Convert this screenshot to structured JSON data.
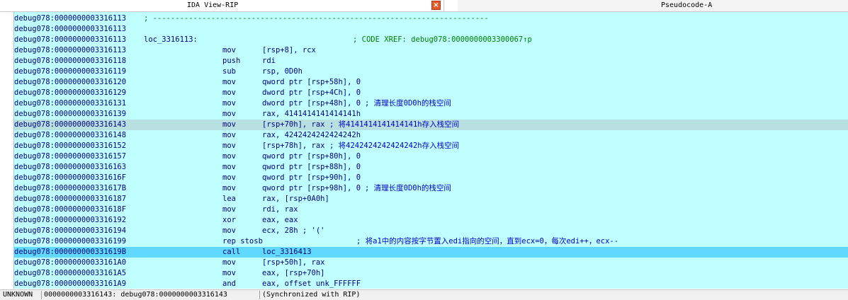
{
  "tabs": {
    "ida_view": "IDA View-RIP",
    "close": "×",
    "pseudocode": "Pseudocode-A"
  },
  "rows": [
    {
      "addr": "debug078:0000000003316113",
      "sep": "; ---------------------------------------------------------------------------"
    },
    {
      "addr": "debug078:0000000003316113"
    },
    {
      "addr": "debug078:0000000003316113",
      "label": "loc_3316113:",
      "comment": "; CODE XREF: debug078:0000000003300067↑p"
    },
    {
      "addr": "debug078:0000000003316113",
      "mn": "mov",
      "op": "[rsp+8], rcx"
    },
    {
      "addr": "debug078:0000000003316118",
      "mn": "push",
      "op": "rdi"
    },
    {
      "addr": "debug078:0000000003316119",
      "mn": "sub",
      "op": "rsp, 0D0h"
    },
    {
      "addr": "debug078:0000000003316120",
      "mn": "mov",
      "op": "qword ptr [rsp+58h], 0"
    },
    {
      "addr": "debug078:0000000003316129",
      "mn": "mov",
      "op": "dword ptr [rsp+4Ch], 0"
    },
    {
      "addr": "debug078:0000000003316131",
      "mn": "mov",
      "op": "dword ptr [rsp+48h], 0",
      "comment": "; 清理长度0D0h的栈空间"
    },
    {
      "addr": "debug078:0000000003316139",
      "mn": "mov",
      "op": "rax, 4141414141414141h"
    },
    {
      "addr": "debug078:0000000003316143",
      "mn": "mov",
      "op": "[rsp+70h], rax",
      "comment": "; 将4141414141414141h存入栈空间",
      "state": "cur"
    },
    {
      "addr": "debug078:0000000003316148",
      "mn": "mov",
      "op": "rax, 4242424242424242h"
    },
    {
      "addr": "debug078:0000000003316152",
      "mn": "mov",
      "op": "[rsp+78h], rax",
      "comment": "; 将4242424242424242h存入栈空间"
    },
    {
      "addr": "debug078:0000000003316157",
      "mn": "mov",
      "op": "qword ptr [rsp+80h], 0"
    },
    {
      "addr": "debug078:0000000003316163",
      "mn": "mov",
      "op": "qword ptr [rsp+88h], 0"
    },
    {
      "addr": "debug078:000000000331616F",
      "mn": "mov",
      "op": "qword ptr [rsp+90h], 0"
    },
    {
      "addr": "debug078:000000000331617B",
      "mn": "mov",
      "op": "qword ptr [rsp+98h], 0",
      "comment": "; 清理长度0D0h的栈空间"
    },
    {
      "addr": "debug078:0000000003316187",
      "mn": "lea",
      "op": "rax, [rsp+0A0h]"
    },
    {
      "addr": "debug078:000000000331618F",
      "mn": "mov",
      "op": "rdi, rax"
    },
    {
      "addr": "debug078:0000000003316192",
      "mn": "xor",
      "op": "eax, eax"
    },
    {
      "addr": "debug078:0000000003316194",
      "mn": "mov",
      "op": "ecx, 28h ; '('"
    },
    {
      "addr": "debug078:0000000003316199",
      "mn": "rep stosb",
      "op": "",
      "comment": "; 将a1中的内容按字节置入edi指向的空间，直到ecx=0，每次edi++，ecx--"
    },
    {
      "addr": "debug078:000000000331619B",
      "mn": "call",
      "op": "loc_3316413",
      "state": "hl"
    },
    {
      "addr": "debug078:00000000033161A0",
      "mn": "mov",
      "op": "[rsp+50h], rax"
    },
    {
      "addr": "debug078:00000000033161A5",
      "mn": "mov",
      "op": "eax, [rsp+70h]"
    },
    {
      "addr": "debug078:00000000033161A9",
      "mn": "and",
      "op": "eax, offset unk_FFFFFF"
    }
  ],
  "status": {
    "mode": "UNKNOWN",
    "position": "0000000003316143: debug078:0000000003316143",
    "sync": "(Synchronized with RIP)"
  }
}
